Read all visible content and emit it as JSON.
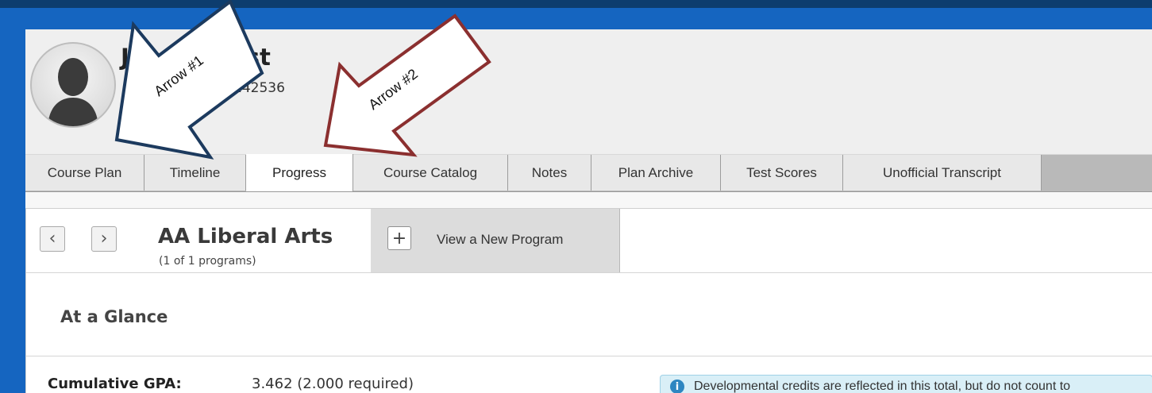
{
  "student": {
    "name": "John Ateest",
    "id_partial": "142536"
  },
  "tabs": [
    {
      "label": "Course Plan"
    },
    {
      "label": "Timeline"
    },
    {
      "label": "Progress"
    },
    {
      "label": "Course Catalog"
    },
    {
      "label": "Notes"
    },
    {
      "label": "Plan Archive"
    },
    {
      "label": "Test Scores"
    },
    {
      "label": "Unofficial Transcript"
    }
  ],
  "program": {
    "title": "AA Liberal Arts",
    "subtitle": "(1 of 1 programs)",
    "prev_glyph": "‹",
    "next_glyph": "›",
    "new_program_plus": "+",
    "new_program_label": "View a New Program"
  },
  "glance": {
    "heading": "At a Glance",
    "gpa_label": "Cumulative GPA:",
    "gpa_value": "3.462 (2.000 required)",
    "info_icon": "i",
    "info_text": "Developmental credits are reflected in this total, but do not count to"
  },
  "annotations": {
    "arrow1_label": "Arrow #1",
    "arrow2_label": "Arrow #2",
    "arrow1_color": "#1c3a5e",
    "arrow2_color": "#8b2f2f"
  }
}
